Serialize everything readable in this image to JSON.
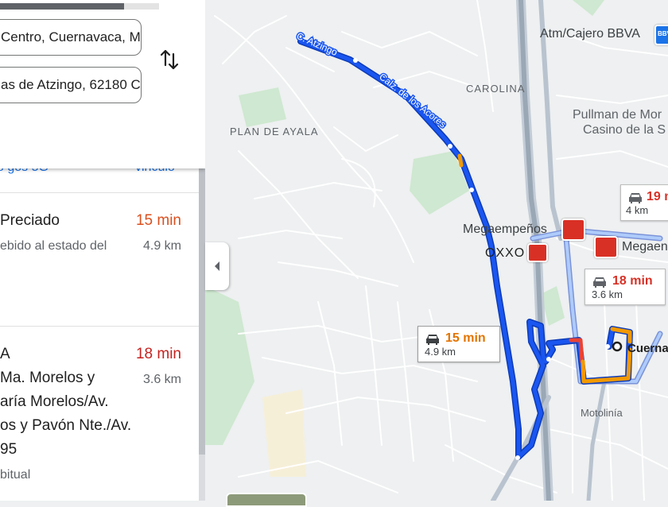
{
  "panel": {
    "progress_fraction": 0.78,
    "origin_value": "Centro, Cuernavaca, M",
    "destination_value": "as de Atzingo, 62180 C",
    "peek_left": "o gos 5G",
    "peek_right": "vinculo",
    "routes": [
      {
        "title": "Preciado",
        "subtitle": "ebido al estado del",
        "time": "15 min",
        "distance": "4.9 km",
        "time_color": "#e37400"
      },
      {
        "title": "A",
        "lines": [
          "Ma. Morelos y",
          "aría Morelos/Av.",
          "os y Pavón Nte./Av.",
          "95"
        ],
        "note": "bitual",
        "time": "18 min",
        "distance": "3.6 km",
        "time_color": "#d93025"
      }
    ]
  },
  "map": {
    "labels": {
      "atm": "Atm/Cajero BBVA",
      "bank_badge": "BBVA",
      "carolina": "CAROLINA",
      "plan_de_ayala": "PLAN DE AYALA",
      "pullman_1": "Pullman de Mor",
      "pullman_2": "Casino de la S",
      "megaempenos_1": "Megaempeños",
      "megaempenos_2": "Megaen",
      "oxxo": "OXXO",
      "motolinia": "Motolinía",
      "cuernavaca": "Cuerna",
      "street_atzingo": "C. Atzingo",
      "street_acores": "Calz. de los Acores"
    },
    "callouts": [
      {
        "time": "15 min",
        "distance": "4.9 km",
        "time_color": "#e37400",
        "selected": true
      },
      {
        "time": "18 min",
        "distance": "3.6 km",
        "time_color": "#d93025",
        "selected": false
      },
      {
        "time": "19 m",
        "distance": "4 km",
        "time_color": "#d93025",
        "selected": false
      }
    ],
    "colors": {
      "route_selected": "#1a56f0",
      "route_alt": "#aecbfa",
      "traffic_orange": "#f29900",
      "traffic_red": "#ea4335",
      "park_green": "#c8e6c9",
      "poi_red": "#d93025"
    }
  }
}
